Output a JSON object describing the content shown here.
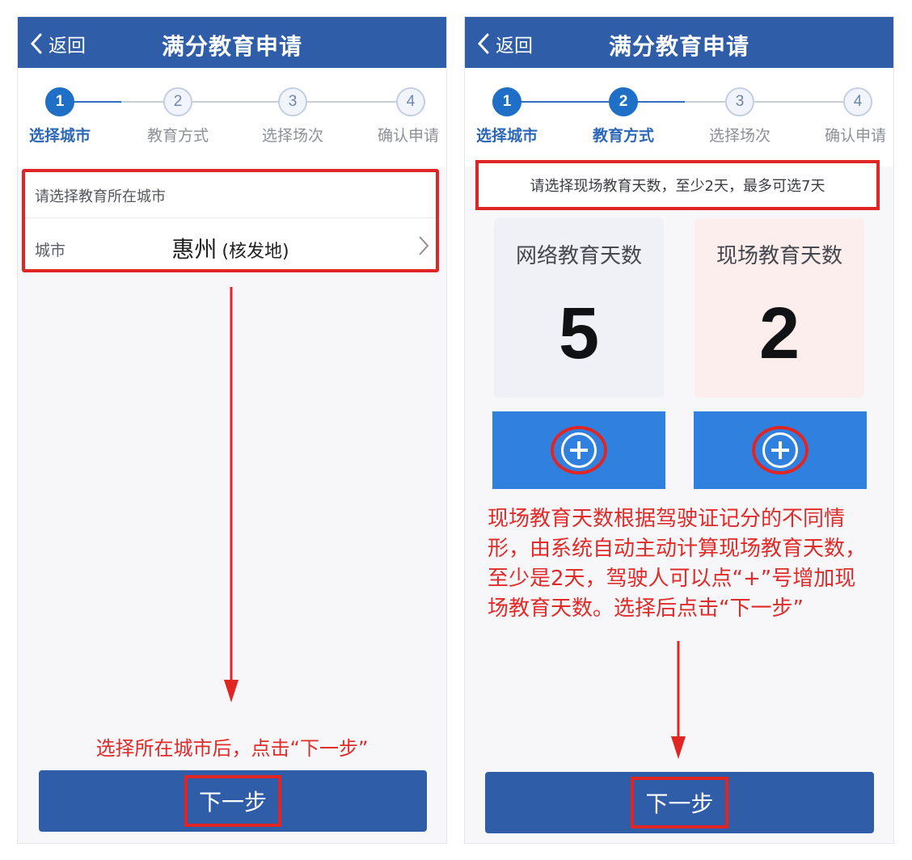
{
  "left_screen": {
    "nav": {
      "back_label": "返回",
      "title": "满分教育申请"
    },
    "steps": [
      {
        "number": "1",
        "label": "选择城市"
      },
      {
        "number": "2",
        "label": "教育方式"
      },
      {
        "number": "3",
        "label": "选择场次"
      },
      {
        "number": "4",
        "label": "确认申请"
      }
    ],
    "city_card": {
      "title": "请选择教育所在城市",
      "label": "城市",
      "value": "惠州",
      "suffix": "(核发地)"
    },
    "annotation": "选择所在城市后，点击“下一步”",
    "next_button": "下一步"
  },
  "right_screen": {
    "nav": {
      "back_label": "返回",
      "title": "满分教育申请"
    },
    "steps": [
      {
        "number": "1",
        "label": "选择城市"
      },
      {
        "number": "2",
        "label": "教育方式"
      },
      {
        "number": "3",
        "label": "选择场次"
      },
      {
        "number": "4",
        "label": "确认申请"
      }
    ],
    "hint": "请选择现场教育天数，至少2天，最多可选7天",
    "online_days": {
      "title": "网络教育天数",
      "value": "5"
    },
    "onsite_days": {
      "title": "现场教育天数",
      "value": "2"
    },
    "annotation": "现场教育天数根据驾驶证记分的不同情形，由系统自动主动计算现场教育天数，至少是2天，驾驶人可以点“+”号增加现场教育天数。选择后点击“下一步”",
    "next_button": "下一步"
  },
  "colors": {
    "primary_blue": "#2f5da8",
    "active_step": "#1f6fc6",
    "annotation_red": "#e12b29",
    "plus_button_blue": "#2f80df"
  },
  "icons": {
    "back": "chevron-left-icon",
    "city_arrow": "chevron-right-icon",
    "plus": "plus-icon",
    "arrow": "down-arrow-icon"
  }
}
